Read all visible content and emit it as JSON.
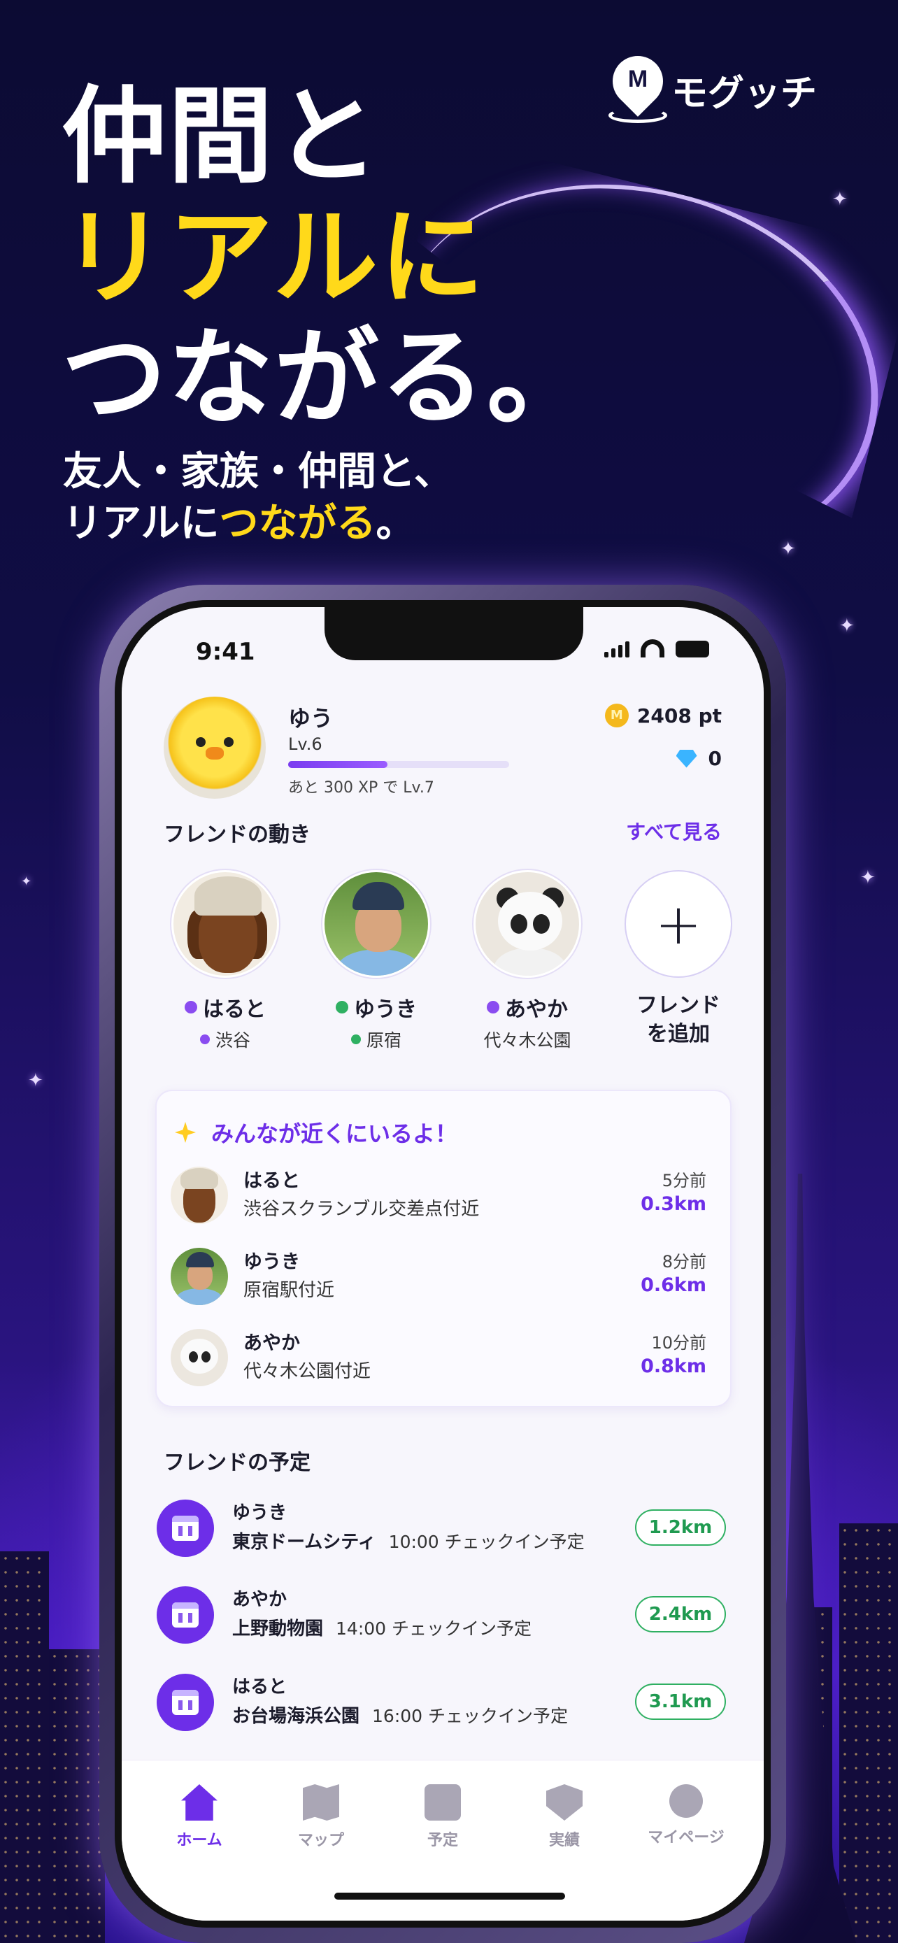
{
  "brand": {
    "logo_letter": "M",
    "name": "モグッチ"
  },
  "hero": {
    "line1": "仲間と",
    "line2": "リアルに",
    "line3": "つながる。",
    "sub_line1": "友人・家族・仲間と、",
    "sub_line2_prefix": "リアルに",
    "sub_line2_highlight": "つながる",
    "sub_line2_suffix": "。"
  },
  "status_bar": {
    "time": "9:41"
  },
  "profile": {
    "name": "ゆう",
    "level": "Lv.6",
    "xp_progress": 0.45,
    "xp_note": "あと 300 XP で Lv.7",
    "coin_letter": "M",
    "points": "2408 pt",
    "gems": "0"
  },
  "friend_activity": {
    "title": "フレンドの動き",
    "see_all": "すべて見る",
    "friends": [
      {
        "name": "はると",
        "location": "渋谷",
        "status_color": "#8a4cf0"
      },
      {
        "name": "ゆうき",
        "location": "原宿",
        "status_color": "#2fb062"
      },
      {
        "name": "あやか",
        "location": "代々木公園",
        "status_color": "#8a4cf0"
      }
    ],
    "add_line1": "フレンド",
    "add_line2": "を追加"
  },
  "nearby": {
    "title": "みんなが近くにいるよ！",
    "items": [
      {
        "name": "はると",
        "place": "渋谷スクランブル交差点付近",
        "time": "5分前",
        "distance": "0.3km"
      },
      {
        "name": "ゆうき",
        "place": "原宿駅付近",
        "time": "8分前",
        "distance": "0.6km"
      },
      {
        "name": "あやか",
        "place": "代々木公園付近",
        "time": "10分前",
        "distance": "0.8km"
      }
    ]
  },
  "schedules": {
    "title": "フレンドの予定",
    "items": [
      {
        "name": "ゆうき",
        "venue": "東京ドームシティ",
        "detail": "10:00 チェックイン予定",
        "distance": "1.2km"
      },
      {
        "name": "あやか",
        "venue": "上野動物園",
        "detail": "14:00 チェックイン予定",
        "distance": "2.4km"
      },
      {
        "name": "はると",
        "venue": "お台場海浜公園",
        "detail": "16:00 チェックイン予定",
        "distance": "3.1km"
      }
    ]
  },
  "tabbar": {
    "items": [
      {
        "label": "ホーム",
        "icon": "home-icon",
        "active": true
      },
      {
        "label": "マップ",
        "icon": "map-icon",
        "active": false
      },
      {
        "label": "予定",
        "icon": "calendar-icon",
        "active": false
      },
      {
        "label": "実績",
        "icon": "badge-icon",
        "active": false
      },
      {
        "label": "マイページ",
        "icon": "user-icon",
        "active": false
      }
    ]
  },
  "colors": {
    "accent": "#6d2ee8",
    "highlight": "#ffd91a",
    "distance_green": "#2fb062"
  }
}
